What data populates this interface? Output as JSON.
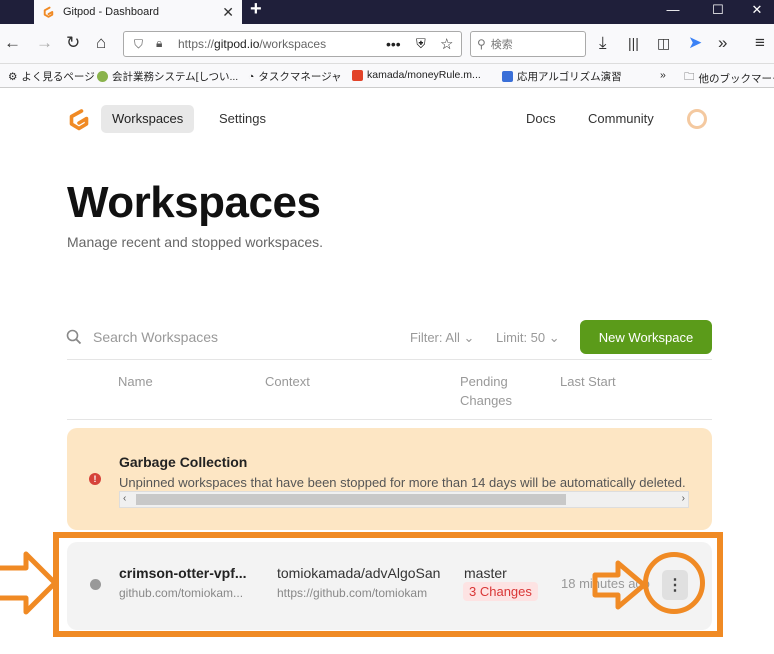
{
  "browser": {
    "tab_title": "Gitpod - Dashboard",
    "url_prefix": "https://",
    "url_domain": "gitpod.io",
    "url_path": "/workspaces",
    "search_placeholder": "検索",
    "bookmarks": [
      "よく見るページ",
      "会計業務システム[しつい...",
      "タスクマネージャ",
      "kamada/moneyRule.m...",
      "応用アルゴリズム演習",
      "他のブックマーク"
    ]
  },
  "nav": {
    "workspaces": "Workspaces",
    "settings": "Settings",
    "docs": "Docs",
    "community": "Community"
  },
  "header": {
    "title": "Workspaces",
    "subtitle": "Manage recent and stopped workspaces."
  },
  "toolbar": {
    "search_placeholder": "Search Workspaces",
    "filter": "Filter: All",
    "limit": "Limit: 50",
    "new_workspace": "New Workspace"
  },
  "table": {
    "columns": [
      "Name",
      "Context",
      "Pending Changes",
      "Last Start"
    ]
  },
  "garbage": {
    "title": "Garbage Collection",
    "text": "Unpinned workspaces that have been stopped for more than 14 days will be automatically deleted."
  },
  "workspace": {
    "name": "crimson-otter-vpf...",
    "repo": "github.com/tomiokam...",
    "context": "tomiokamada/advAlgoSan",
    "context_url": "https://github.com/tomiokam",
    "branch": "master",
    "changes": "3 Changes",
    "last_start": "18 minutes ago"
  },
  "colors": {
    "accent": "#5b9b1a",
    "annotation": "#f08a24",
    "warning_bg": "#fde6c4"
  }
}
